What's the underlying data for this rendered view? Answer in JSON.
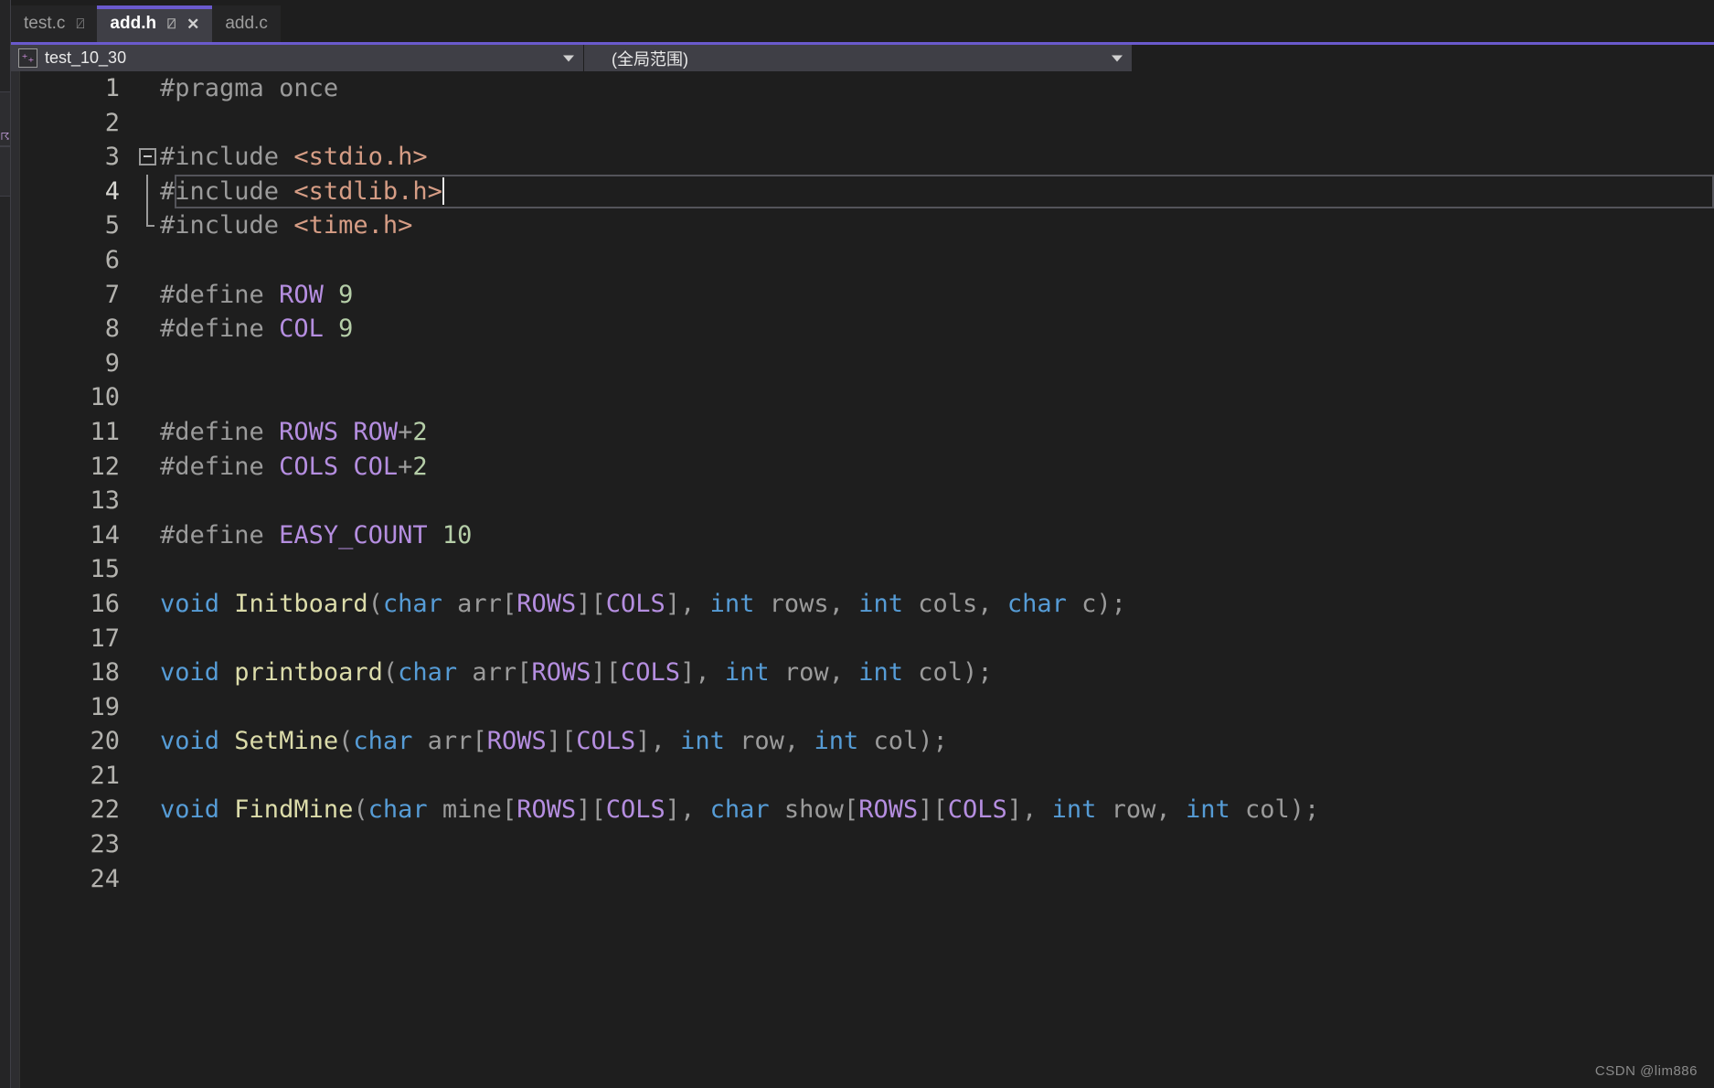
{
  "window": {
    "background": "#1e1e1e",
    "accent": "#6a5acd"
  },
  "tabbar": {
    "tabs": [
      {
        "label": "test.c",
        "active": false,
        "pin_icon": "⍁",
        "has_close": false
      },
      {
        "label": "add.h",
        "active": true,
        "pin_icon": "⍁",
        "has_close": true,
        "close_icon": "✕"
      },
      {
        "label": "add.c",
        "active": false,
        "pin_icon": "",
        "has_close": false
      }
    ]
  },
  "navbar": {
    "project_scope": {
      "value": "test_10_30",
      "icon": "⁺₊",
      "arrow_icon": "chevron-down-icon"
    },
    "member_scope": {
      "value": "(全局范围)",
      "arrow_icon": "chevron-down-icon"
    }
  },
  "editor": {
    "language": "c-header",
    "current_line": 4,
    "colors": {
      "preprocessor": "#9b9b9b",
      "include_path": "#d69d85",
      "macro_name": "#b58ee0",
      "number": "#b5cea8",
      "keyword": "#569cd6",
      "function_name": "#dcdcaa",
      "identifier": "#9b9b9b",
      "line_number": "#b3b2ae"
    },
    "lines": [
      {
        "n": "1",
        "fold": "none",
        "text": "#pragma once"
      },
      {
        "n": "2",
        "fold": "none",
        "text": ""
      },
      {
        "n": "3",
        "fold": "start",
        "text": "#include <stdio.h>"
      },
      {
        "n": "4",
        "fold": "bar",
        "text": "#include <stdlib.h>"
      },
      {
        "n": "5",
        "fold": "end",
        "text": "#include <time.h>"
      },
      {
        "n": "6",
        "fold": "none",
        "text": ""
      },
      {
        "n": "7",
        "fold": "none",
        "text": "#define ROW 9"
      },
      {
        "n": "8",
        "fold": "none",
        "text": "#define COL 9"
      },
      {
        "n": "9",
        "fold": "none",
        "text": ""
      },
      {
        "n": "10",
        "fold": "none",
        "text": ""
      },
      {
        "n": "11",
        "fold": "none",
        "text": "#define ROWS ROW+2"
      },
      {
        "n": "12",
        "fold": "none",
        "text": "#define COLS COL+2"
      },
      {
        "n": "13",
        "fold": "none",
        "text": ""
      },
      {
        "n": "14",
        "fold": "none",
        "text": "#define EASY_COUNT 10"
      },
      {
        "n": "15",
        "fold": "none",
        "text": ""
      },
      {
        "n": "16",
        "fold": "none",
        "text": "void Initboard(char arr[ROWS][COLS], int rows, int cols, char c);"
      },
      {
        "n": "17",
        "fold": "none",
        "text": ""
      },
      {
        "n": "18",
        "fold": "none",
        "text": "void printboard(char arr[ROWS][COLS], int row, int col);"
      },
      {
        "n": "19",
        "fold": "none",
        "text": ""
      },
      {
        "n": "20",
        "fold": "none",
        "text": "void SetMine(char arr[ROWS][COLS], int row, int col);"
      },
      {
        "n": "21",
        "fold": "none",
        "text": ""
      },
      {
        "n": "22",
        "fold": "none",
        "text": "void FindMine(char mine[ROWS][COLS], char show[ROWS][COLS], int row, int col);"
      },
      {
        "n": "23",
        "fold": "none",
        "text": ""
      },
      {
        "n": "24",
        "fold": "none",
        "text": ""
      }
    ]
  },
  "watermark": {
    "text": "CSDN @lim886"
  }
}
